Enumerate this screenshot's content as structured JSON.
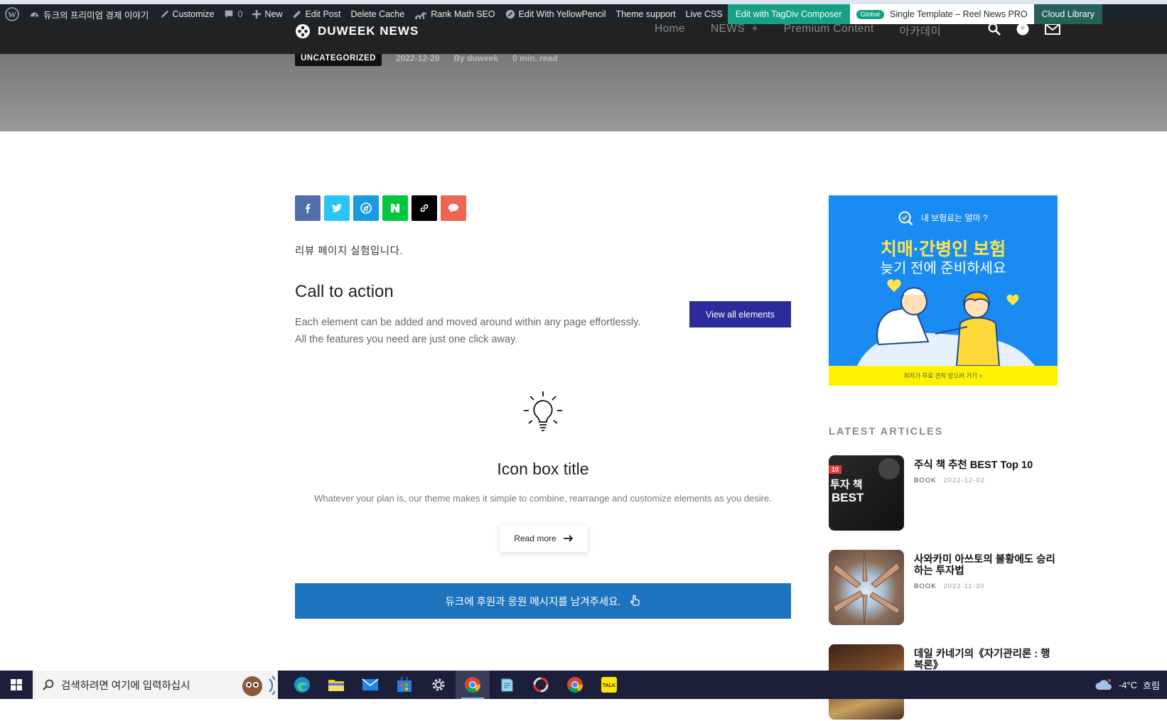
{
  "admin_bar": {
    "site_name": "듀크의 프리미엄 경제 이야기",
    "customize": "Customize",
    "comments_count": "0",
    "new": "New",
    "edit_post": "Edit Post",
    "delete_cache": "Delete Cache",
    "rank_math": "Rank Math SEO",
    "yellowpencil": "Edit With YellowPencil",
    "theme_support": "Theme support",
    "live_css": "Live CSS",
    "tagdiv": "Edit with TagDiv Composer",
    "global_badge": "Global",
    "template": "Single Template – Reel News PRO",
    "cloud_library": "Cloud Library"
  },
  "header": {
    "logo_text": "DUWEEK NEWS",
    "nav": [
      "Home",
      "NEWS  +",
      "Premium Content",
      "아카데미"
    ]
  },
  "post_meta": {
    "category": "UNCATEGORIZED",
    "date": "2022-12-29",
    "author": "By duweek",
    "read_time": "0 min. read"
  },
  "content": {
    "intro": "리뷰 페이지 실험입니다.",
    "cta_title": "Call to action",
    "cta_line1": "Each element can be added and moved around within any page effortlessly.",
    "cta_line2": "All the features you need are just one click away.",
    "cta_button": "View all elements",
    "icon_box_title": "Icon box title",
    "icon_box_desc": "Whatever your plan is, our theme makes it simple to combine, rearrange and customize elements as you desire.",
    "read_more": "Read more",
    "support_text": "듀크에 후원과 응원 메시지를 남겨주세요."
  },
  "sidebar": {
    "ad_top": "내 보험료는 얼마 ?",
    "ad_headline": "치매·간병인 보험",
    "ad_subline": "늦기 전에 준비하세요",
    "ad_bottom": "최저가 무료 견적 받으러 가기 >",
    "latest_heading": "LATEST ARTICLES",
    "articles": [
      {
        "title": "주식 책 추천 BEST Top 10",
        "category": "BOOK",
        "date": "2022-12-02",
        "thumb_text1": "투자 책",
        "thumb_text2": "BEST",
        "thumb_badge": "10"
      },
      {
        "title": "사와카미 아쓰토의 불황에도 승리하는 투자법",
        "category": "BOOK",
        "date": "2022-11-30"
      },
      {
        "title": "데일 카네기의《자기관리론 : 행복론》",
        "category": "",
        "date": ""
      }
    ]
  },
  "taskbar": {
    "search_placeholder": "검색하려면 여기에 입력하십시",
    "weather": "-4°C",
    "weather_desc": "흐림"
  },
  "colors": {
    "admin_bg": "#1d2327",
    "cta_button": "#2b2b9a",
    "support_bar": "#1e73be",
    "facebook": "#516eab",
    "twitter": "#29c5f6",
    "telegram": "#179cde",
    "naver": "#00c73c",
    "copy_link": "#000000",
    "kakao": "#ec6651"
  }
}
